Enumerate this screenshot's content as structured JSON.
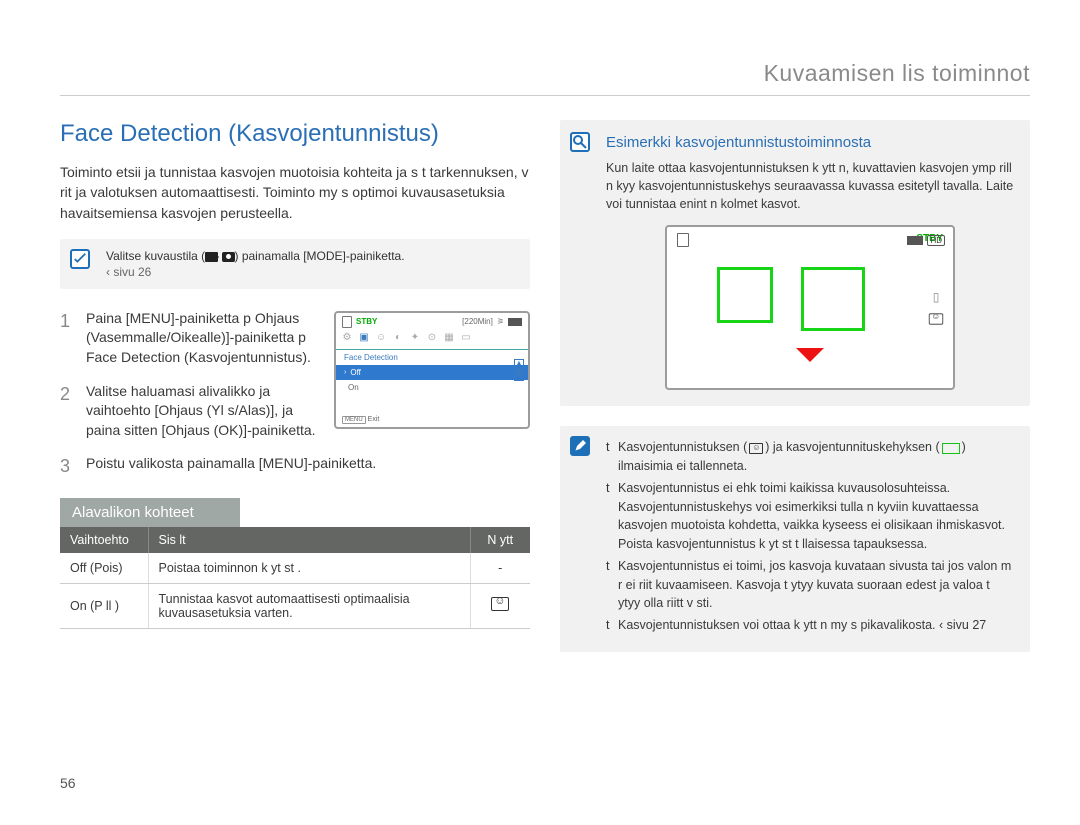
{
  "header": {
    "breadcrumb": "Kuvaamisen lis toiminnot"
  },
  "title": "Face Detection (Kasvojentunnistus)",
  "intro": "Toiminto etsii ja tunnistaa kasvojen muotoisia kohteita ja s t tarkennuksen, v rit ja valotuksen automaattisesti. Toiminto my s optimoi kuvausasetuksia havaitsemiensa kasvojen perusteella.",
  "modebox": {
    "text": "Valitse kuvaustila (    ) painamalla [MODE]-painiketta.",
    "sub": "‹ sivu 26"
  },
  "steps": [
    "Paina [MENU]-painiketta p Ohjaus (Vasemmalle/Oikealle)]-painiketta p Face Detection (Kasvojentunnistus).",
    "Valitse haluamasi alivalikko ja vaihtoehto [Ohjaus (Yl s/Alas)], ja paina sitten [Ohjaus (OK)]-painiketta.",
    "Poistu valikosta painamalla [MENU]-painiketta."
  ],
  "lcd": {
    "stby": "STBY",
    "time": "[220Min]",
    "menu_title": "Face Detection",
    "sel": "Off",
    "item": "On",
    "exit_btn": "MENU",
    "exit_text": "Exit"
  },
  "subhead": "Alavalikon kohteet",
  "table": {
    "headers": [
      "Vaihtoehto",
      "Sis lt",
      "N ytt"
    ],
    "rows": [
      {
        "opt": "Off (Pois)",
        "desc": "Poistaa toiminnon k yt st .",
        "disp": "-"
      },
      {
        "opt": "On (P ll )",
        "desc": "Tunnistaa kasvot automaattisesti optimaalisia kuvausasetuksia varten.",
        "disp": "icon"
      }
    ]
  },
  "example": {
    "title": "Esimerkki kasvojentunnistustoiminnosta",
    "text": "Kun laite ottaa kasvojentunnistuksen k ytt n, kuvattavien kasvojen ymp rill n kyy kasvojentunnistuskehys seuraavassa kuvassa esitetyll tavalla. Laite voi tunnistaa enint n kolmet kasvot.",
    "stby": "STBY",
    "hd": "HD"
  },
  "notes": [
    "Kasvojentunnistuksen (   ) ja kasvojentunnituskehyksen (   ) ilmaisimia ei tallenneta.",
    "Kasvojentunnistus ei ehk  toimi kaikissa kuvausolosuhteissa. Kasvojentunnistuskehys voi esimerkiksi tulla n kyviin kuvattaessa kasvojen muotoista kohdetta, vaikka kyseess  ei olisikaan ihmiskasvot. Poista kasvojentunnistus k yt st  t llaisessa tapauksessa.",
    "Kasvojentunnistus ei toimi, jos kasvoja kuvataan sivusta tai jos valon m r  ei riit  kuvaamiseen. Kasvoja t ytyy kuvata suoraan edest  ja valoa t ytyy olla riitt v sti.",
    "Kasvojentunnistuksen voi ottaa k ytt n my s pikavalikosta. ‹ sivu 27"
  ],
  "pagenum": "56"
}
